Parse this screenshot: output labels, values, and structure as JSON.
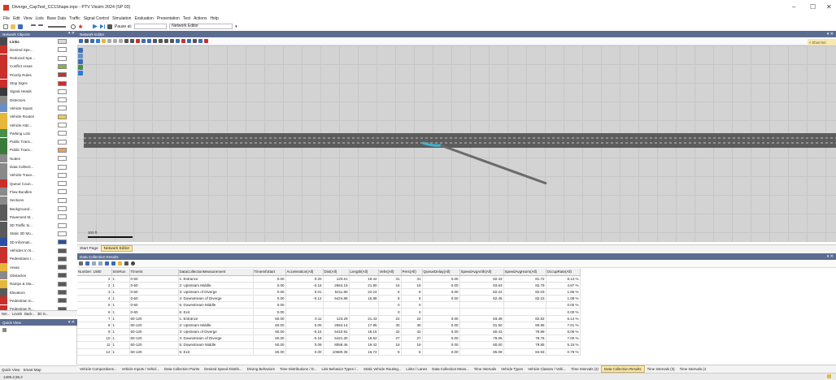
{
  "window": {
    "title": "Diverge_CapTest_CC1Shape.inpx - PTV Vissim 2024 (SP 03)",
    "minimize_label": "–",
    "maximize_label": "☐",
    "close_label": "✕"
  },
  "menu": [
    "File",
    "Edit",
    "View",
    "Lists",
    "Base Data",
    "Traffic",
    "Signal Control",
    "Simulation",
    "Evaluation",
    "Presentation",
    "Test",
    "Actions",
    "Help"
  ],
  "toolbar": {
    "pause_label": "Pause at:",
    "editor_select": "Network Editor"
  },
  "network_objects": {
    "title": "Network Objects",
    "pin_label": "▾ ✕",
    "items": [
      {
        "label": "Links",
        "color": "#d9d9d9",
        "icon_color": "#4a4a4a",
        "selected": true
      },
      {
        "label": "Desired Spe...",
        "color": "#ffffff",
        "icon_color": "#c9302c"
      },
      {
        "label": "Reduced Spe...",
        "color": "#ffffff",
        "icon_color": "#c9302c"
      },
      {
        "label": "Conflict Areas",
        "color": "#8ab04c",
        "icon_color": "#c9302c"
      },
      {
        "label": "Priority Rules",
        "color": "#c9302c",
        "icon_color": "#c9302c"
      },
      {
        "label": "Stop Signs",
        "color": "#c9302c",
        "icon_color": "#c9302c"
      },
      {
        "label": "Signal Heads",
        "color": "#ffffff",
        "icon_color": "#3a3a3a"
      },
      {
        "label": "Detectors",
        "color": "#ffffff",
        "icon_color": "#8a8a8a"
      },
      {
        "label": "Vehicle Inputs",
        "color": "#ffffff",
        "icon_color": "#6a8fc4"
      },
      {
        "label": "Vehicle Routes",
        "color": "#f2c94c",
        "icon_color": "#e6b73a"
      },
      {
        "label": "Vehicle Attri...",
        "color": "#ffffff",
        "icon_color": "#e6b73a"
      },
      {
        "label": "Parking Lots",
        "color": "#ffffff",
        "icon_color": "#4a8c4a"
      },
      {
        "label": "Public Trans...",
        "color": "#ffffff",
        "icon_color": "#3a7a3a"
      },
      {
        "label": "Public Trans...",
        "color": "#e8a060",
        "icon_color": "#3a7a3a"
      },
      {
        "label": "Nodes",
        "color": "#ffffff",
        "icon_color": "#8a8a8a"
      },
      {
        "label": "Data Collecti...",
        "color": "#ffffff",
        "icon_color": "#8a8a8a"
      },
      {
        "label": "Vehicle Trave...",
        "color": "#ffffff",
        "icon_color": "#8a8a8a"
      },
      {
        "label": "Queue Coun...",
        "color": "#ffffff",
        "icon_color": "#c9302c"
      },
      {
        "label": "Flow Bundles",
        "color": "#ffffff",
        "icon_color": "#8a8a8a"
      },
      {
        "label": "Sections",
        "color": "#ffffff",
        "icon_color": "#8a8a8a"
      },
      {
        "label": "Background...",
        "color": "#ffffff",
        "icon_color": "#5a5a5a"
      },
      {
        "label": "Pavement M...",
        "color": "#ffffff",
        "icon_color": "#5a5a5a"
      },
      {
        "label": "3D Traffic Si...",
        "color": "#ffffff",
        "icon_color": "#5a5a5a"
      },
      {
        "label": "Static 3D Mo...",
        "color": "#ffffff",
        "icon_color": "#5a5a5a"
      },
      {
        "label": "3D Informati...",
        "color": "#2a4fa0",
        "icon_color": "#2a4fa0"
      },
      {
        "label": "Vehicles In N...",
        "color": "#5a5a5a",
        "icon_color": "#c9302c"
      },
      {
        "label": "Pedestrians I...",
        "color": "#5a5a5a",
        "icon_color": "#c9302c"
      },
      {
        "label": "Areas",
        "color": "#5a5a5a",
        "icon_color": "#e6b73a"
      },
      {
        "label": "Obstacles",
        "color": "#5a5a5a",
        "icon_color": "#8a8a8a"
      },
      {
        "label": "Ramps & Sta...",
        "color": "#5a5a5a",
        "icon_color": "#e6b73a"
      },
      {
        "label": "Elevators",
        "color": "#5a5a5a",
        "icon_color": "#5a5a5a"
      },
      {
        "label": "Pedestrian In...",
        "color": "#5a5a5a",
        "icon_color": "#c9302c"
      },
      {
        "label": "Pedestrian R...",
        "color": "#5a5a5a",
        "icon_color": "#c9302c"
      }
    ],
    "tabs": [
      "Net...",
      "Levels",
      "Back...",
      "3D In..."
    ]
  },
  "quick_view": {
    "title": "Quick View",
    "pin_label": "▾ ✕",
    "tabs": [
      "Quick View",
      "Smart Map"
    ]
  },
  "network_editor": {
    "title": "Network Editor",
    "pin_label": "▾ ✕",
    "short_label": "< Short hel",
    "scale_label": "200 ft",
    "tabs": [
      {
        "label": "Start Page",
        "active": false
      },
      {
        "label": "Network Editor",
        "active": true
      }
    ]
  },
  "results": {
    "title": "Data Collection Results",
    "pin_label": "▾ ✕",
    "columns": [
      "Number: 1980",
      "SimRun",
      "TimeInt",
      "DataCollectionMeasurement",
      "TimeInt\\Start",
      "Acceleration(All)",
      "Dist(All)",
      "Length(All)",
      "Vehs(All)",
      "Pers(All)",
      "QueueDelay(All)",
      "SpeedAvgArith(All)",
      "SpeedAvgHarm(All)",
      "OccupRate(All)"
    ],
    "rows": [
      [
        "2",
        "1",
        "0-60",
        "1: Entrance",
        "0.00",
        "0.20",
        "120.61",
        "19.42",
        "31",
        "31",
        "0.00",
        "82.43",
        "81.72",
        "8.13 %"
      ],
      [
        "2",
        "1",
        "0-60",
        "2: Upstream Middle",
        "0.00",
        "-0.16",
        "2664.19",
        "21.90",
        "16",
        "16",
        "0.00",
        "83.63",
        "82.79",
        "4.87 %"
      ],
      [
        "3",
        "1",
        "0-60",
        "3: Upstream of Diverge",
        "0.00",
        "0.01",
        "5411.80",
        "22.24",
        "6",
        "6",
        "0.00",
        "82.22",
        "82.03",
        "1.86 %"
      ],
      [
        "4",
        "1",
        "0-60",
        "4: Downstream of Diverge",
        "0.00",
        "-0.12",
        "5424.88",
        "15.88",
        "5",
        "5",
        "0.00",
        "82.45",
        "82.23",
        "1.08 %"
      ],
      [
        "5",
        "1",
        "0-60",
        "5: Downstream Middle",
        "0.00",
        "",
        "",
        "",
        "0",
        "0",
        "",
        "",
        "",
        "0.00 %"
      ],
      [
        "6",
        "1",
        "0-60",
        "6: Exit",
        "0.00",
        "",
        "",
        "",
        "0",
        "0",
        "",
        "",
        "",
        "0.00 %"
      ],
      [
        "7",
        "1",
        "60-120",
        "1: Entrance",
        "60.00",
        "0.11",
        "123.29",
        "21.43",
        "22",
        "22",
        "0.00",
        "83.49",
        "82.82",
        "6.14 %"
      ],
      [
        "8",
        "1",
        "60-120",
        "2: Upstream Middle",
        "60.00",
        "0.00",
        "2664.14",
        "17.96",
        "30",
        "30",
        "0.00",
        "81.50",
        "80.85",
        "7.61 %"
      ],
      [
        "9",
        "1",
        "60-120",
        "3: Upstream of Diverge",
        "60.00",
        "-0.15",
        "5410.91",
        "18.15",
        "32",
        "32",
        "0.00",
        "80.43",
        "79.99",
        "8.06 %"
      ],
      [
        "10",
        "1",
        "60-120",
        "4: Downstream of Diverge",
        "60.00",
        "-0.18",
        "5421.30",
        "18.52",
        "27",
        "27",
        "0.00",
        "79.06",
        "78.76",
        "7.00 %"
      ],
      [
        "11",
        "1",
        "60-120",
        "5: Downstream Middle",
        "60.00",
        "0.09",
        "8058.46",
        "19.42",
        "19",
        "19",
        "0.00",
        "80.00",
        "79.85",
        "5.15 %"
      ],
      [
        "12",
        "1",
        "60-120",
        "6: Exit",
        "60.00",
        "0.00",
        "10680.35",
        "16.72",
        "6",
        "6",
        "0.00",
        "85.09",
        "84.93",
        "0.79 %"
      ]
    ]
  },
  "bottom_tabs": [
    {
      "label": "Vehicle Compositions...",
      "active": false
    },
    {
      "label": "Vehicle Inputs / Vehicl...",
      "active": false
    },
    {
      "label": "Data Collection Points",
      "active": false
    },
    {
      "label": "Desired Speed Distrib...",
      "active": false
    },
    {
      "label": "Driving Behaviors",
      "active": false
    },
    {
      "label": "Time Distributions / D...",
      "active": false
    },
    {
      "label": "Link Behavior Types /...",
      "active": false
    },
    {
      "label": "Static Vehicle Routing...",
      "active": false
    },
    {
      "label": "Links / Lanes",
      "active": false
    },
    {
      "label": "Data Collection Meas...",
      "active": false
    },
    {
      "label": "Time Intervals",
      "active": false
    },
    {
      "label": "Vehicle Types",
      "active": false
    },
    {
      "label": "Vehicle Classes / Vehi...",
      "active": false
    },
    {
      "label": "Time Intervals (2)",
      "active": false
    },
    {
      "label": "Data Collection Results",
      "active": true
    },
    {
      "label": "Time Intervals (3)",
      "active": false
    },
    {
      "label": "Time Intervals (4",
      "active": false
    }
  ],
  "status": {
    "coords": "1409.4;36.2"
  }
}
